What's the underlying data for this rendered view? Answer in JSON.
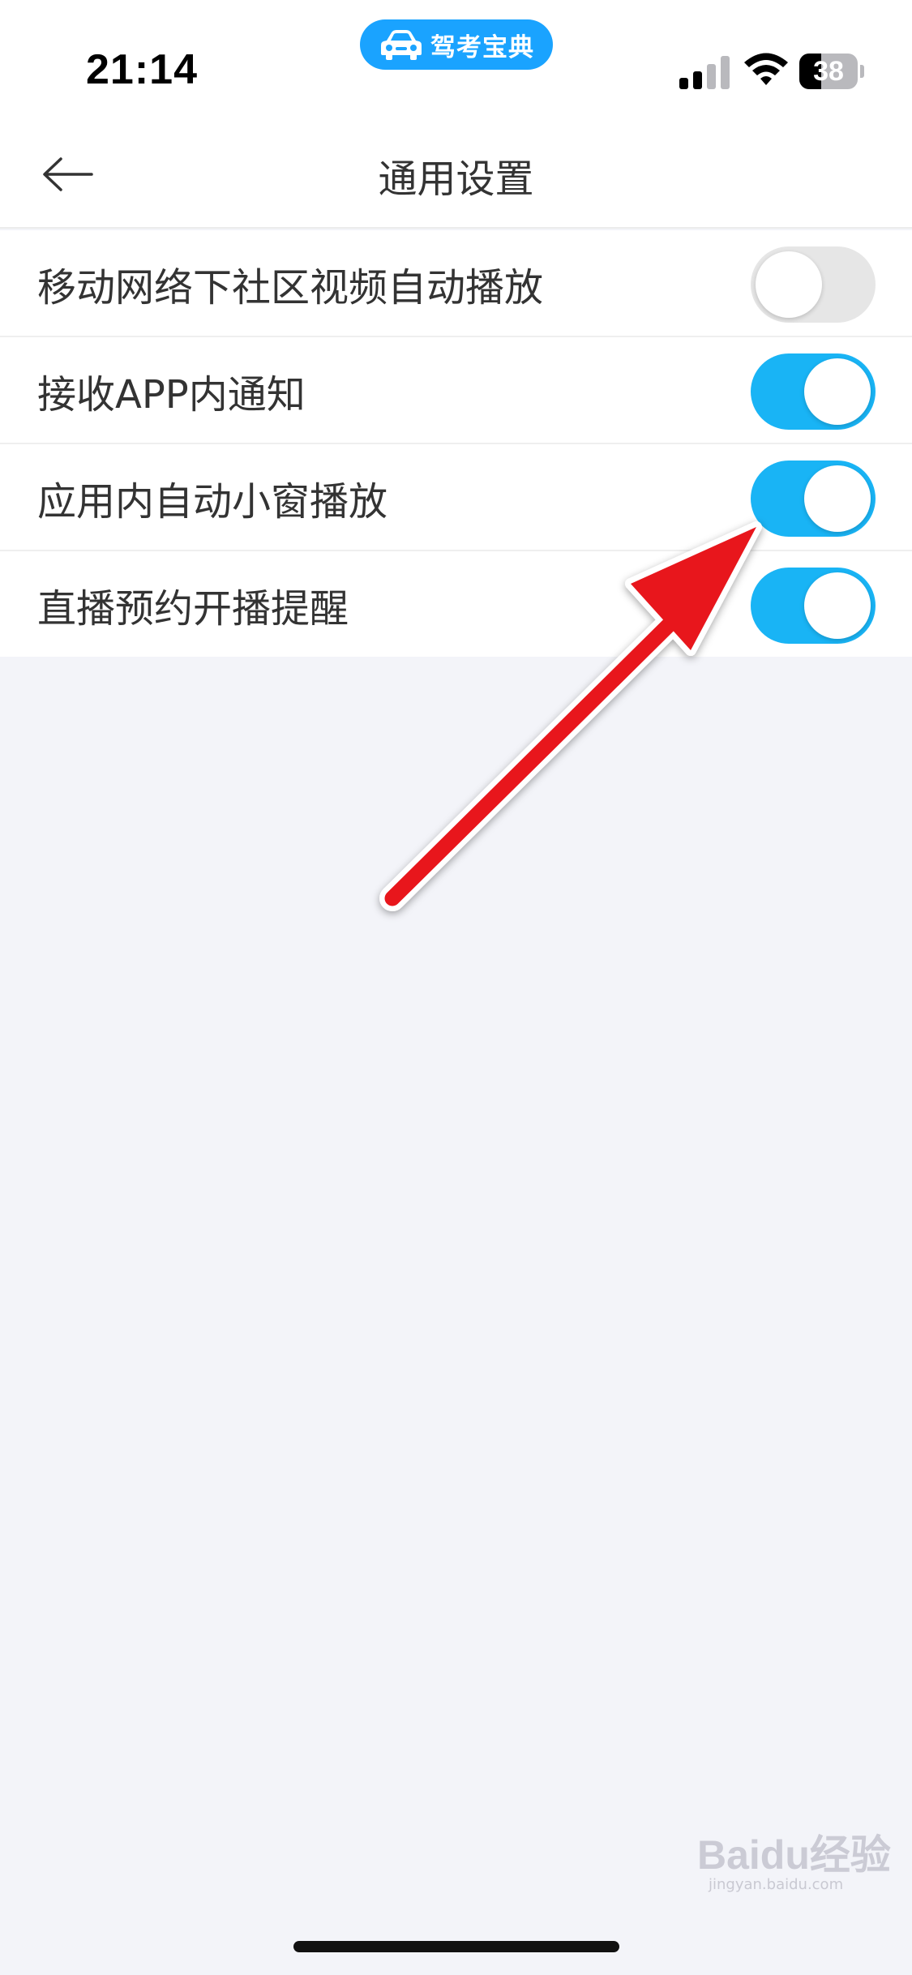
{
  "status_bar": {
    "time": "21:14",
    "app_badge": "驾考宝典",
    "battery_level": "38",
    "battery_fraction": 0.38
  },
  "header": {
    "title": "通用设置",
    "back_icon": "arrow-left-icon"
  },
  "settings": [
    {
      "label": "移动网络下社区视频自动播放",
      "enabled": false
    },
    {
      "label": "接收APP内通知",
      "enabled": true
    },
    {
      "label": "应用内自动小窗播放",
      "enabled": true
    },
    {
      "label": "直播预约开播提醒",
      "enabled": true
    }
  ],
  "watermark": {
    "logo_text": "Baidu经验",
    "url_text": "jingyan.baidu.com"
  },
  "colors": {
    "toggle_on": "#19b4f5",
    "toggle_off": "#e6e6e6",
    "app_badge": "#1aa3ff",
    "annotation_arrow": "#e8141c",
    "background": "#f3f4f9"
  }
}
